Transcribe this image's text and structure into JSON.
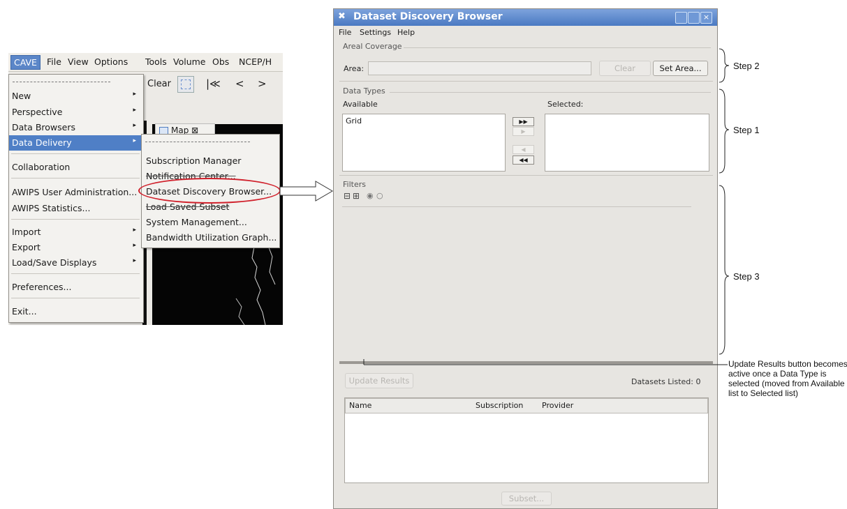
{
  "cave": {
    "menubar": [
      "CAVE",
      "File",
      "View",
      "Options",
      "Tools",
      "Volume",
      "Obs",
      "NCEP/H"
    ],
    "toolbar": {
      "clear": "Clear",
      "first": "|≪",
      "prev": "<",
      "next": ">"
    },
    "map_tab": "Map ⊠",
    "main_menu": {
      "new": "New",
      "perspective": "Perspective",
      "data_browsers": "Data Browsers",
      "data_delivery": "Data Delivery",
      "collaboration": "Collaboration",
      "user_admin": "AWIPS User Administration...",
      "statistics": "AWIPS Statistics...",
      "import": "Import",
      "export": "Export",
      "load_save": "Load/Save Displays",
      "preferences": "Preferences...",
      "exit": "Exit..."
    },
    "sub_menu": {
      "subscription_manager": "Subscription Manager",
      "notification_center": "Notification Center...",
      "dataset_discovery": "Dataset Discovery Browser...",
      "load_saved_subset": "Load Saved Subset",
      "system_management": "System Management...",
      "bandwidth": "Bandwidth Utilization Graph..."
    }
  },
  "browser": {
    "title": "Dataset Discovery Browser",
    "menubar": {
      "file": "File",
      "settings": "Settings",
      "help": "Help"
    },
    "areal_coverage": {
      "group_label": "Areal Coverage",
      "area_label": "Area:",
      "area_value": "",
      "clear_button": "Clear",
      "set_area_button": "Set Area..."
    },
    "data_types": {
      "group_label": "Data Types",
      "available_label": "Available",
      "selected_label": "Selected:",
      "available_items": [
        "Grid"
      ],
      "selected_items": []
    },
    "filters": {
      "group_label": "Filters"
    },
    "update_results_button": "Update Results",
    "datasets_listed": "Datasets Listed: 0",
    "table": {
      "columns": [
        "Name",
        "Subscription",
        "Provider"
      ],
      "rows": []
    },
    "bottom_button": "Subset..."
  },
  "annotations": {
    "step2": "Step 2",
    "step1": "Step 1",
    "step3": "Step 3",
    "note": "Update Results button becomes active once a Data Type is selected (moved from Available list to Selected list)"
  },
  "colors": {
    "highlight_ellipse": "#d0202b",
    "menu_selection": "#4f7fc6",
    "title_bar": "#4a79c2"
  }
}
